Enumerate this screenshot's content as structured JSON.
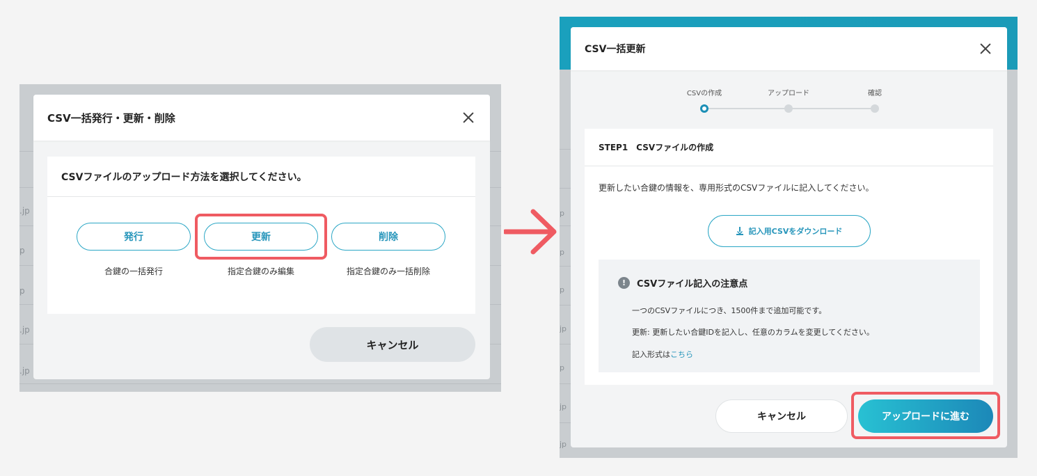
{
  "left_dialog": {
    "title": "CSV一括発行・更新・削除",
    "card_heading": "CSVファイルのアップロード方法を選択してください。",
    "options": [
      {
        "label": "発行",
        "caption": "合鍵の一括発行"
      },
      {
        "label": "更新",
        "caption": "指定合鍵のみ編集"
      },
      {
        "label": "削除",
        "caption": "指定合鍵のみ一括削除"
      }
    ],
    "cancel_label": "キャンセル",
    "background_snippets": [
      ".jp",
      ".jp",
      "p",
      "p",
      ".jp",
      ".jp"
    ]
  },
  "right_dialog": {
    "title": "CSV一括更新",
    "steps": [
      {
        "label": "CSVの作成",
        "active": true
      },
      {
        "label": "アップロード",
        "active": false
      },
      {
        "label": "確認",
        "active": false
      }
    ],
    "step_heading": "STEP1　CSVファイルの作成",
    "description": "更新したい合鍵の情報を、専用形式のCSVファイルに記入してください。",
    "download_label": "記入用CSVをダウンロード",
    "notice": {
      "title": "CSVファイル記入の注意点",
      "line1": "一つのCSVファイルにつき、1500件まで追加可能です。",
      "line2": "更新: 更新したい合鍵IDを記入し、任意のカラムを変更してください。",
      "line3_prefix": "記入形式は",
      "line3_link": "こちら"
    },
    "cancel_label": "キャンセル",
    "next_label": "アップロードに進む",
    "background_snippets": [
      "p",
      "p",
      "p",
      "p",
      "jp",
      "p",
      "jp",
      "jp"
    ]
  },
  "colors": {
    "accent": "#2896bb",
    "highlight": "#ef5b62",
    "teal_header": "#1aa0bd"
  }
}
